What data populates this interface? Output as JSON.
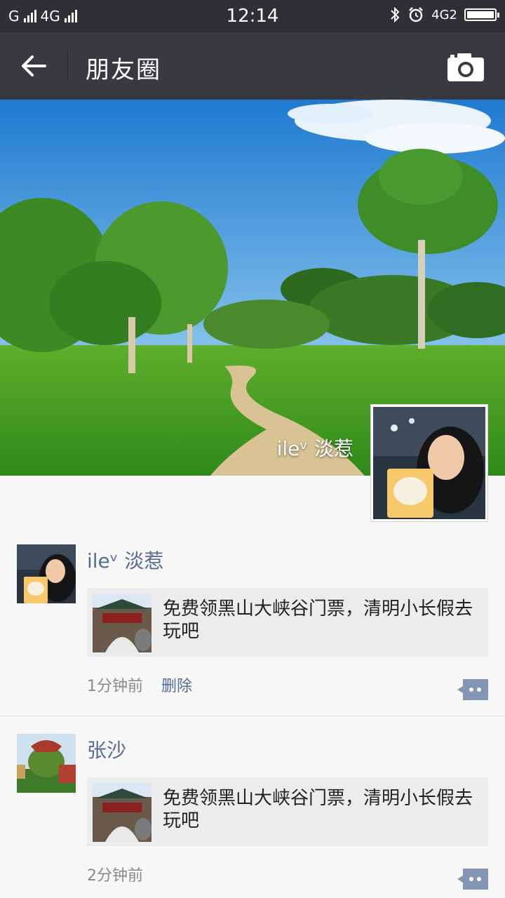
{
  "status_bar": {
    "left_carrier": "G",
    "network": "4G",
    "time": "12:14",
    "right_network": "4G2"
  },
  "nav": {
    "title": "朋友圈"
  },
  "cover": {
    "username": "ileᵛ 淡惹"
  },
  "posts": [
    {
      "author": "ileᵛ 淡惹",
      "link_title": "免费领黑山大峡谷门票，清明小长假去玩吧",
      "time": "1分钟前",
      "delete_label": "删除"
    },
    {
      "author": "张沙",
      "link_title": "免费领黑山大峡谷门票，清明小长假去玩吧",
      "time": "2分钟前"
    }
  ],
  "colors": {
    "nav_bg": "#393a3f",
    "status_bg": "#2e3033",
    "link_blue": "#576b95"
  }
}
